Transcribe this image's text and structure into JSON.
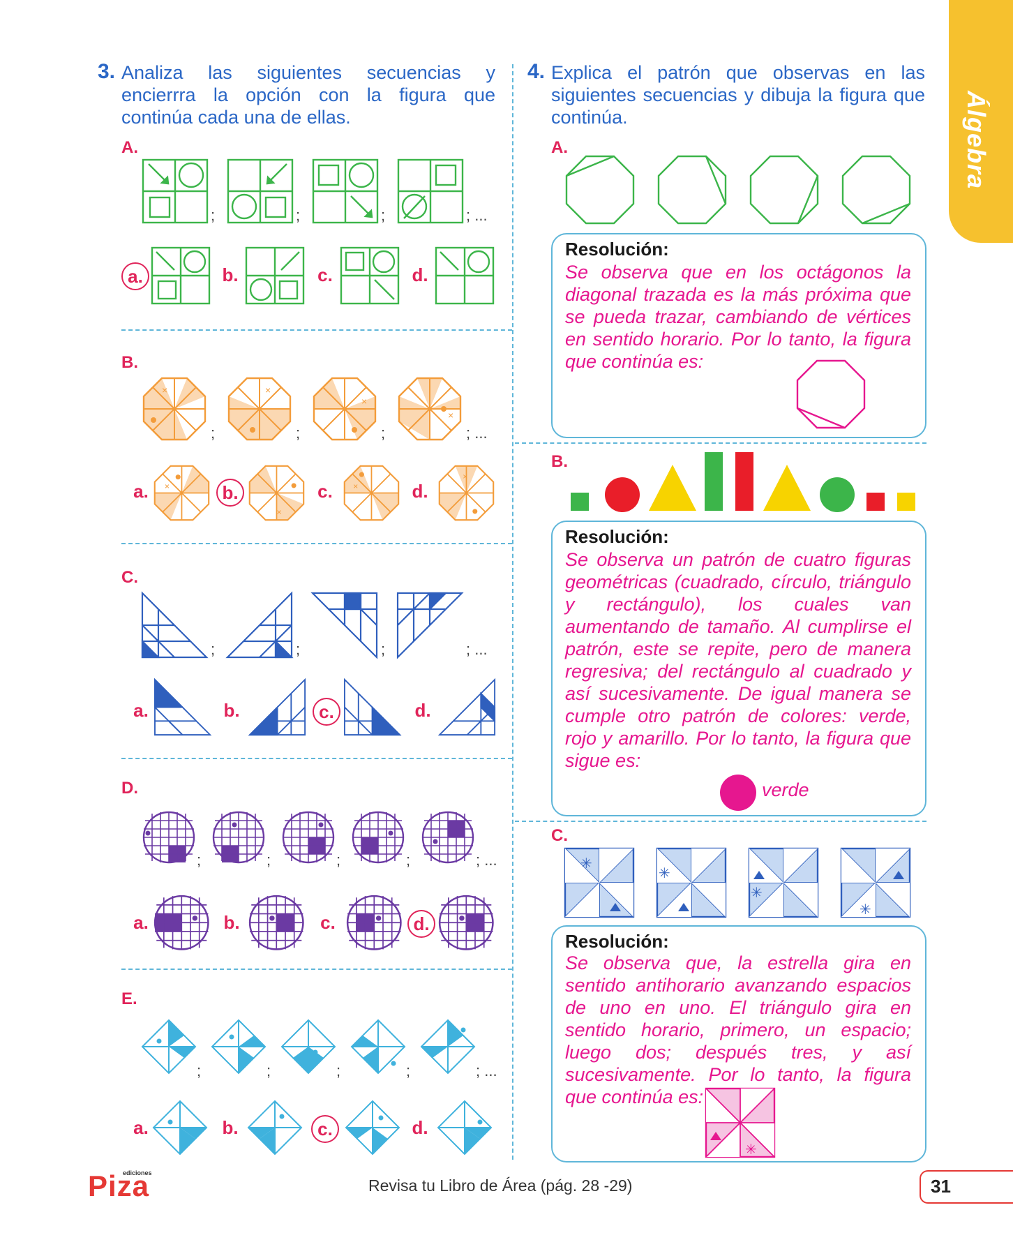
{
  "side_tab": "Álgebra",
  "q3": {
    "number": "3.",
    "text": "Analiza las siguientes secuencias y encierrra la opción con la figura que continúa cada una de ellas.",
    "sections": [
      "A.",
      "B.",
      "C.",
      "D.",
      "E."
    ],
    "options": [
      "a.",
      "b.",
      "c.",
      "d."
    ],
    "selected": {
      "A": "a",
      "B": "b",
      "C": "c",
      "D": "d",
      "E": "c"
    },
    "separator": ";",
    "ellipsis": "; ..."
  },
  "q4": {
    "number": "4.",
    "text": "Explica el patrón que observas en las siguientes secuencias y dibuja la figura que continúa.",
    "A": {
      "label": "A.",
      "resolution_title": "Resolución:",
      "resolution_text": "Se observa que en los octágonos la diagonal trazada es la más próxima que se pueda trazar, cambiando de vértices en sentido horario. Por lo tanto, la figura que continúa es:"
    },
    "B": {
      "label": "B.",
      "resolution_title": "Resolución:",
      "resolution_text": "Se observa un patrón de cuatro figuras geométricas (cuadrado, círculo, triángulo y rectángulo), los cuales van aumentando de tamaño. Al cumplirse el patrón, este se repite, pero de manera regresiva; del rectángulo al cuadrado y así sucesivamente. De igual manera se cumple otro patrón de colores: verde, rojo y amarillo. Por lo tanto, la figura que sigue es:",
      "answer_label": "verde"
    },
    "C": {
      "label": "C.",
      "resolution_title": "Resolución:",
      "resolution_text": "Se observa que, la estrella gira en sentido antihorario avanzando espacios de uno en uno. El triángulo gira en sentido horario, primero, un espacio; luego dos; después tres, y así sucesivamente. Por lo tanto, la figura que continúa es:"
    }
  },
  "footer": {
    "logo": "Piza",
    "logo_small": "ediciones",
    "text": "Revisa tu Libro de Área (pág. 28 -29)",
    "page": "31"
  },
  "colors": {
    "blue_text": "#2b67c6",
    "red": "#e0245a",
    "magenta": "#e6178f",
    "green": "#3cb54a",
    "orange": "#f39c3a",
    "navy": "#2f5fbd",
    "purple": "#6b3aa3",
    "cyan": "#3fb2dd",
    "yellow": "#f6c12e"
  }
}
